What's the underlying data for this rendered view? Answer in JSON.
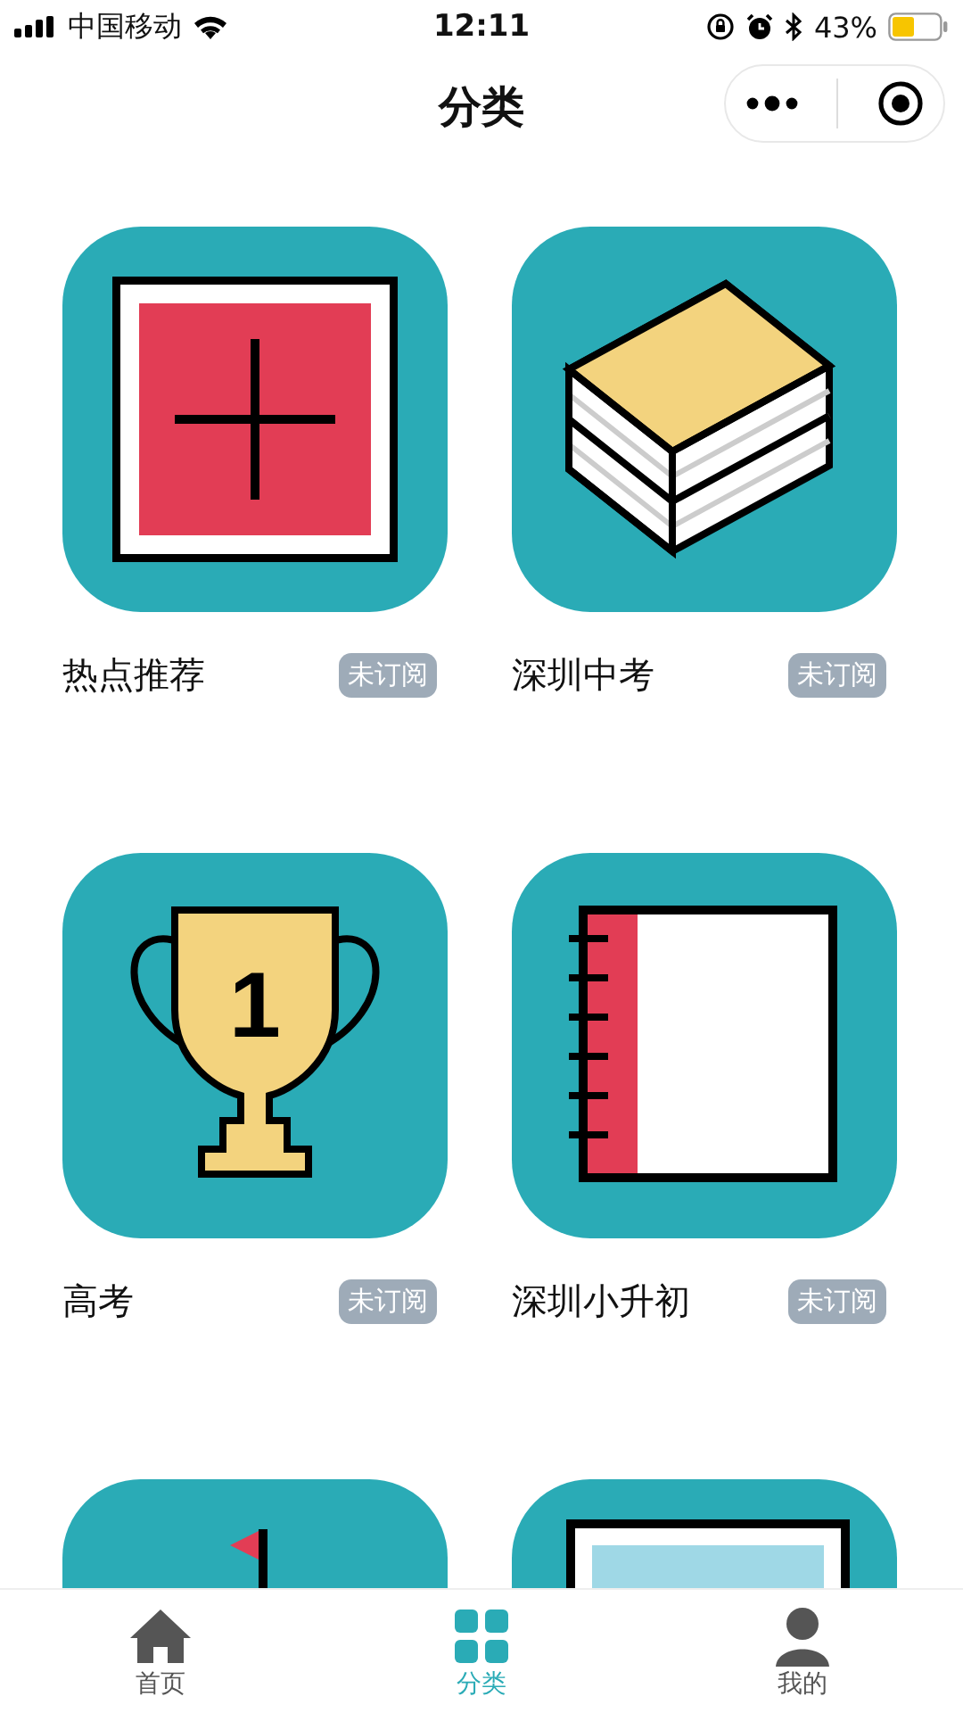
{
  "status_bar": {
    "carrier": "中国移动",
    "time": "12:11",
    "battery": "43%"
  },
  "nav": {
    "title": "分类"
  },
  "categories": [
    {
      "kind": "plus-frame",
      "label": "热点推荐",
      "tag": "未订阅",
      "subscribed": false
    },
    {
      "kind": "books",
      "label": "深圳中考",
      "tag": "未订阅",
      "subscribed": false
    },
    {
      "kind": "trophy",
      "number": "1",
      "label": "高考",
      "tag": "未订阅",
      "subscribed": false
    },
    {
      "kind": "notebook",
      "label": "深圳小升初",
      "tag": "未订阅",
      "subscribed": false
    },
    {
      "kind": "flag"
    },
    {
      "kind": "frame"
    }
  ],
  "tab_bar": [
    {
      "kind": "home",
      "label": "首页",
      "selected": false
    },
    {
      "kind": "grid",
      "label": "分类",
      "selected": true
    },
    {
      "kind": "person",
      "label": "我的",
      "selected": false
    }
  ]
}
